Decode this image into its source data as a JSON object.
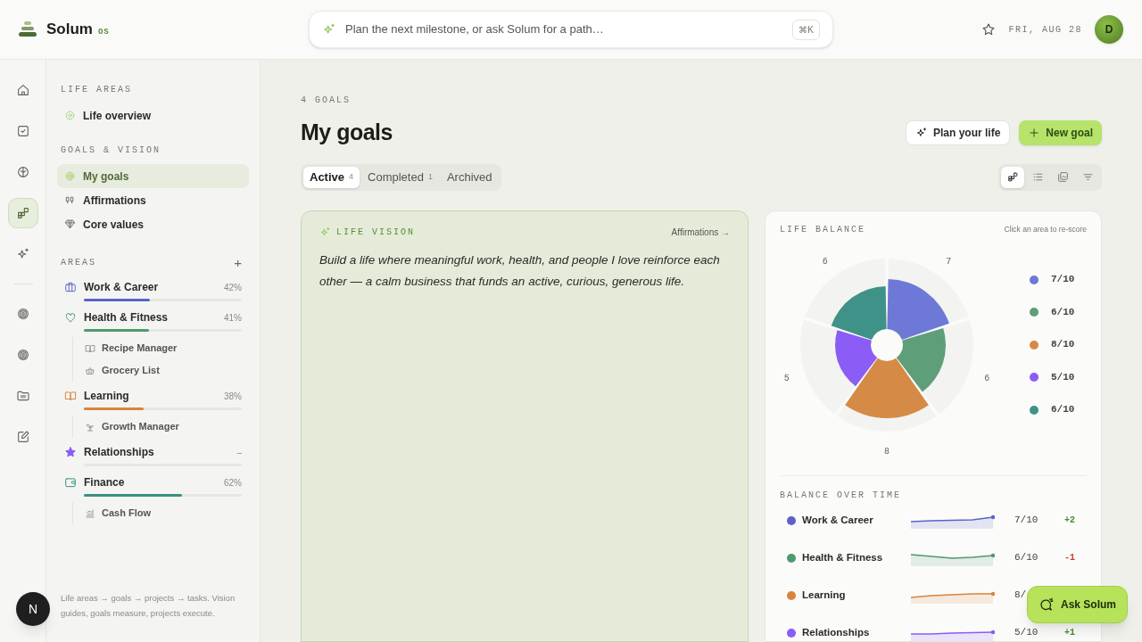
{
  "brand": {
    "name": "Solum",
    "suffix": "OS"
  },
  "search": {
    "placeholder": "Plan the next milestone, or ask Solum for a path…",
    "shortcut": "⌘K"
  },
  "header": {
    "date": "FRI, AUG 28",
    "avatar": "D"
  },
  "rail": [
    {
      "selected": false
    },
    {
      "selected": false
    },
    {
      "selected": false
    },
    {
      "selected": true
    },
    {
      "selected": false
    },
    {
      "kind": "divider"
    },
    {
      "selected": false
    },
    {
      "selected": false
    },
    {
      "selected": false
    },
    {
      "selected": false
    }
  ],
  "sidebar": {
    "sections": [
      {
        "title": "LIFE AREAS",
        "items": [
          {
            "label": "Life overview",
            "selected": false
          }
        ]
      },
      {
        "title": "GOALS & VISION",
        "items": [
          {
            "label": "My goals",
            "selected": true
          },
          {
            "label": "Affirmations",
            "selected": false
          },
          {
            "label": "Core values",
            "selected": false
          }
        ]
      }
    ],
    "areas_title": "AREAS",
    "add": "+",
    "areas": [
      {
        "name": "Work & Career",
        "color": "#5b63c9",
        "percent": "42%",
        "level": 0.42
      },
      {
        "name": "Health & Fitness",
        "color": "#4f9a6e",
        "percent": "41%",
        "level": 0.41,
        "children": [
          {
            "label": "Recipe Manager"
          },
          {
            "label": "Grocery List"
          }
        ]
      },
      {
        "name": "Learning",
        "color": "#d9843a",
        "percent": "38%",
        "level": 0.38,
        "children": [
          {
            "label": "Growth Manager"
          }
        ]
      },
      {
        "name": "Relationships",
        "color": "#8b5cf6",
        "percent": "–"
      },
      {
        "name": "Finance",
        "color": "#3d8f82",
        "percent": "62%",
        "level": 0.62,
        "children": [
          {
            "label": "Cash Flow"
          }
        ]
      }
    ],
    "footer": "Life areas → goals → projects → tasks. Vision guides, goals measure, projects execute."
  },
  "page": {
    "count": "4 GOALS",
    "title": "My goals",
    "actions": [
      {
        "label": "Plan your life",
        "kind": "secondary"
      },
      {
        "label": "New goal",
        "kind": "primary"
      }
    ]
  },
  "tabs": [
    {
      "label": "Active",
      "count": "4",
      "selected": true
    },
    {
      "label": "Completed",
      "count": "1",
      "selected": false
    },
    {
      "label": "Archived",
      "selected": false
    }
  ],
  "views": [
    {
      "selected": true
    },
    {
      "selected": false
    },
    {
      "selected": false
    },
    {
      "selected": false
    }
  ],
  "vision": {
    "title": "LIFE VISION",
    "link": "Affirmations →",
    "text": "Build a life where meaningful work, health, and people I love reinforce each other — a calm business that funds an active, curious, generous life."
  },
  "balance": {
    "title": "LIFE BALANCE",
    "hint": "Click an area to re-score",
    "slices": [
      {
        "label": "7"
      },
      {
        "label": "6"
      },
      {
        "label": "8"
      },
      {
        "label": "5"
      },
      {
        "label": "6"
      }
    ],
    "legend": [
      {
        "color": "#6e78d6",
        "score": "7/10"
      },
      {
        "color": "#5e9e78",
        "score": "6/10"
      },
      {
        "color": "#d58a45",
        "score": "8/10"
      },
      {
        "color": "#8b5cf6",
        "score": "5/10"
      },
      {
        "color": "#3f9287",
        "score": "6/10"
      }
    ]
  },
  "over_time": {
    "title": "BALANCE OVER TIME",
    "rows": [
      {
        "name": "Work & Career",
        "color": "#5b63c9",
        "score": "7/10",
        "delta": "+2",
        "kind": "gain"
      },
      {
        "name": "Health & Fitness",
        "color": "#4f9a6e",
        "score": "6/10",
        "delta": "-1",
        "kind": "loss"
      },
      {
        "name": "Learning",
        "color": "#d9843a",
        "score": "8/"
      },
      {
        "name": "Relationships",
        "color": "#8b5cf6",
        "score": "5/10",
        "delta": "+1",
        "kind": "gain"
      }
    ]
  },
  "assistant": {
    "label": "Ask Solum"
  },
  "workspace": {
    "initial": "N"
  }
}
